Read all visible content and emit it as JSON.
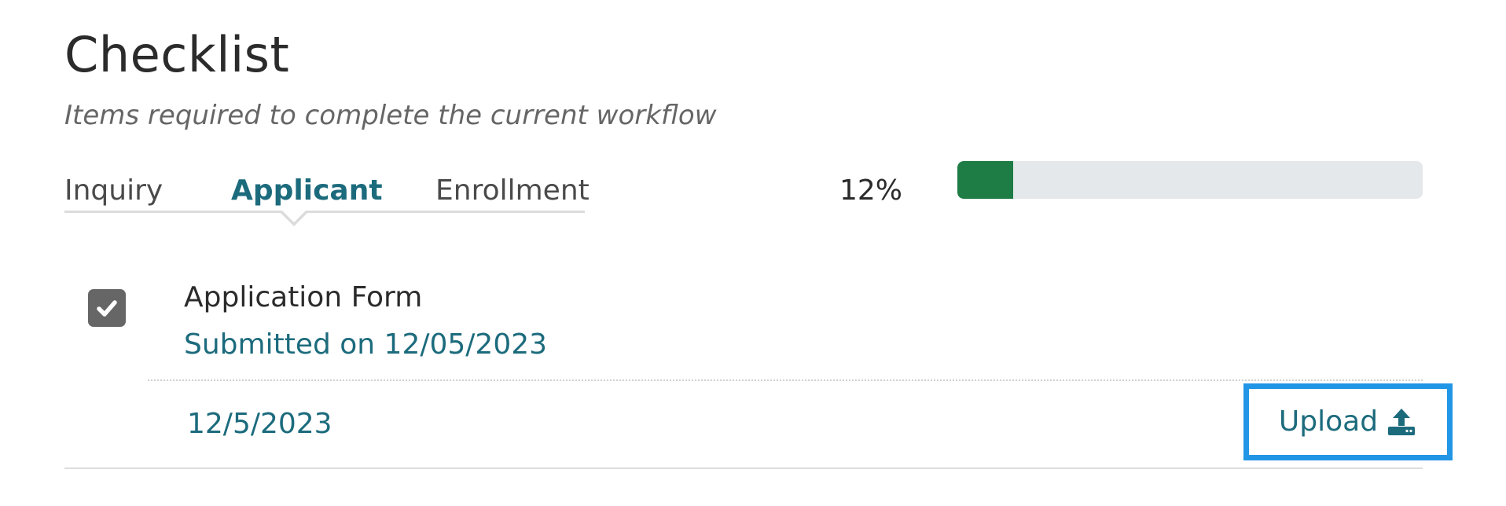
{
  "header": {
    "title": "Checklist",
    "subtitle": "Items required to complete the current workflow"
  },
  "tabs": [
    {
      "label": "Inquiry",
      "active": false
    },
    {
      "label": "Applicant",
      "active": true
    },
    {
      "label": "Enrollment",
      "active": false
    }
  ],
  "progress": {
    "label": "12%",
    "value": 0.12,
    "fill_color": "#1e7c45",
    "track_color": "#e5e8ea"
  },
  "items": [
    {
      "checked": true,
      "title": "Application Form",
      "status": "Submitted on 12/05/2023",
      "date": "12/5/2023",
      "action_label": "Upload",
      "action_icon": "upload-icon"
    }
  ],
  "colors": {
    "accent": "#1c6b7d",
    "focus_outline": "#2196e6"
  }
}
